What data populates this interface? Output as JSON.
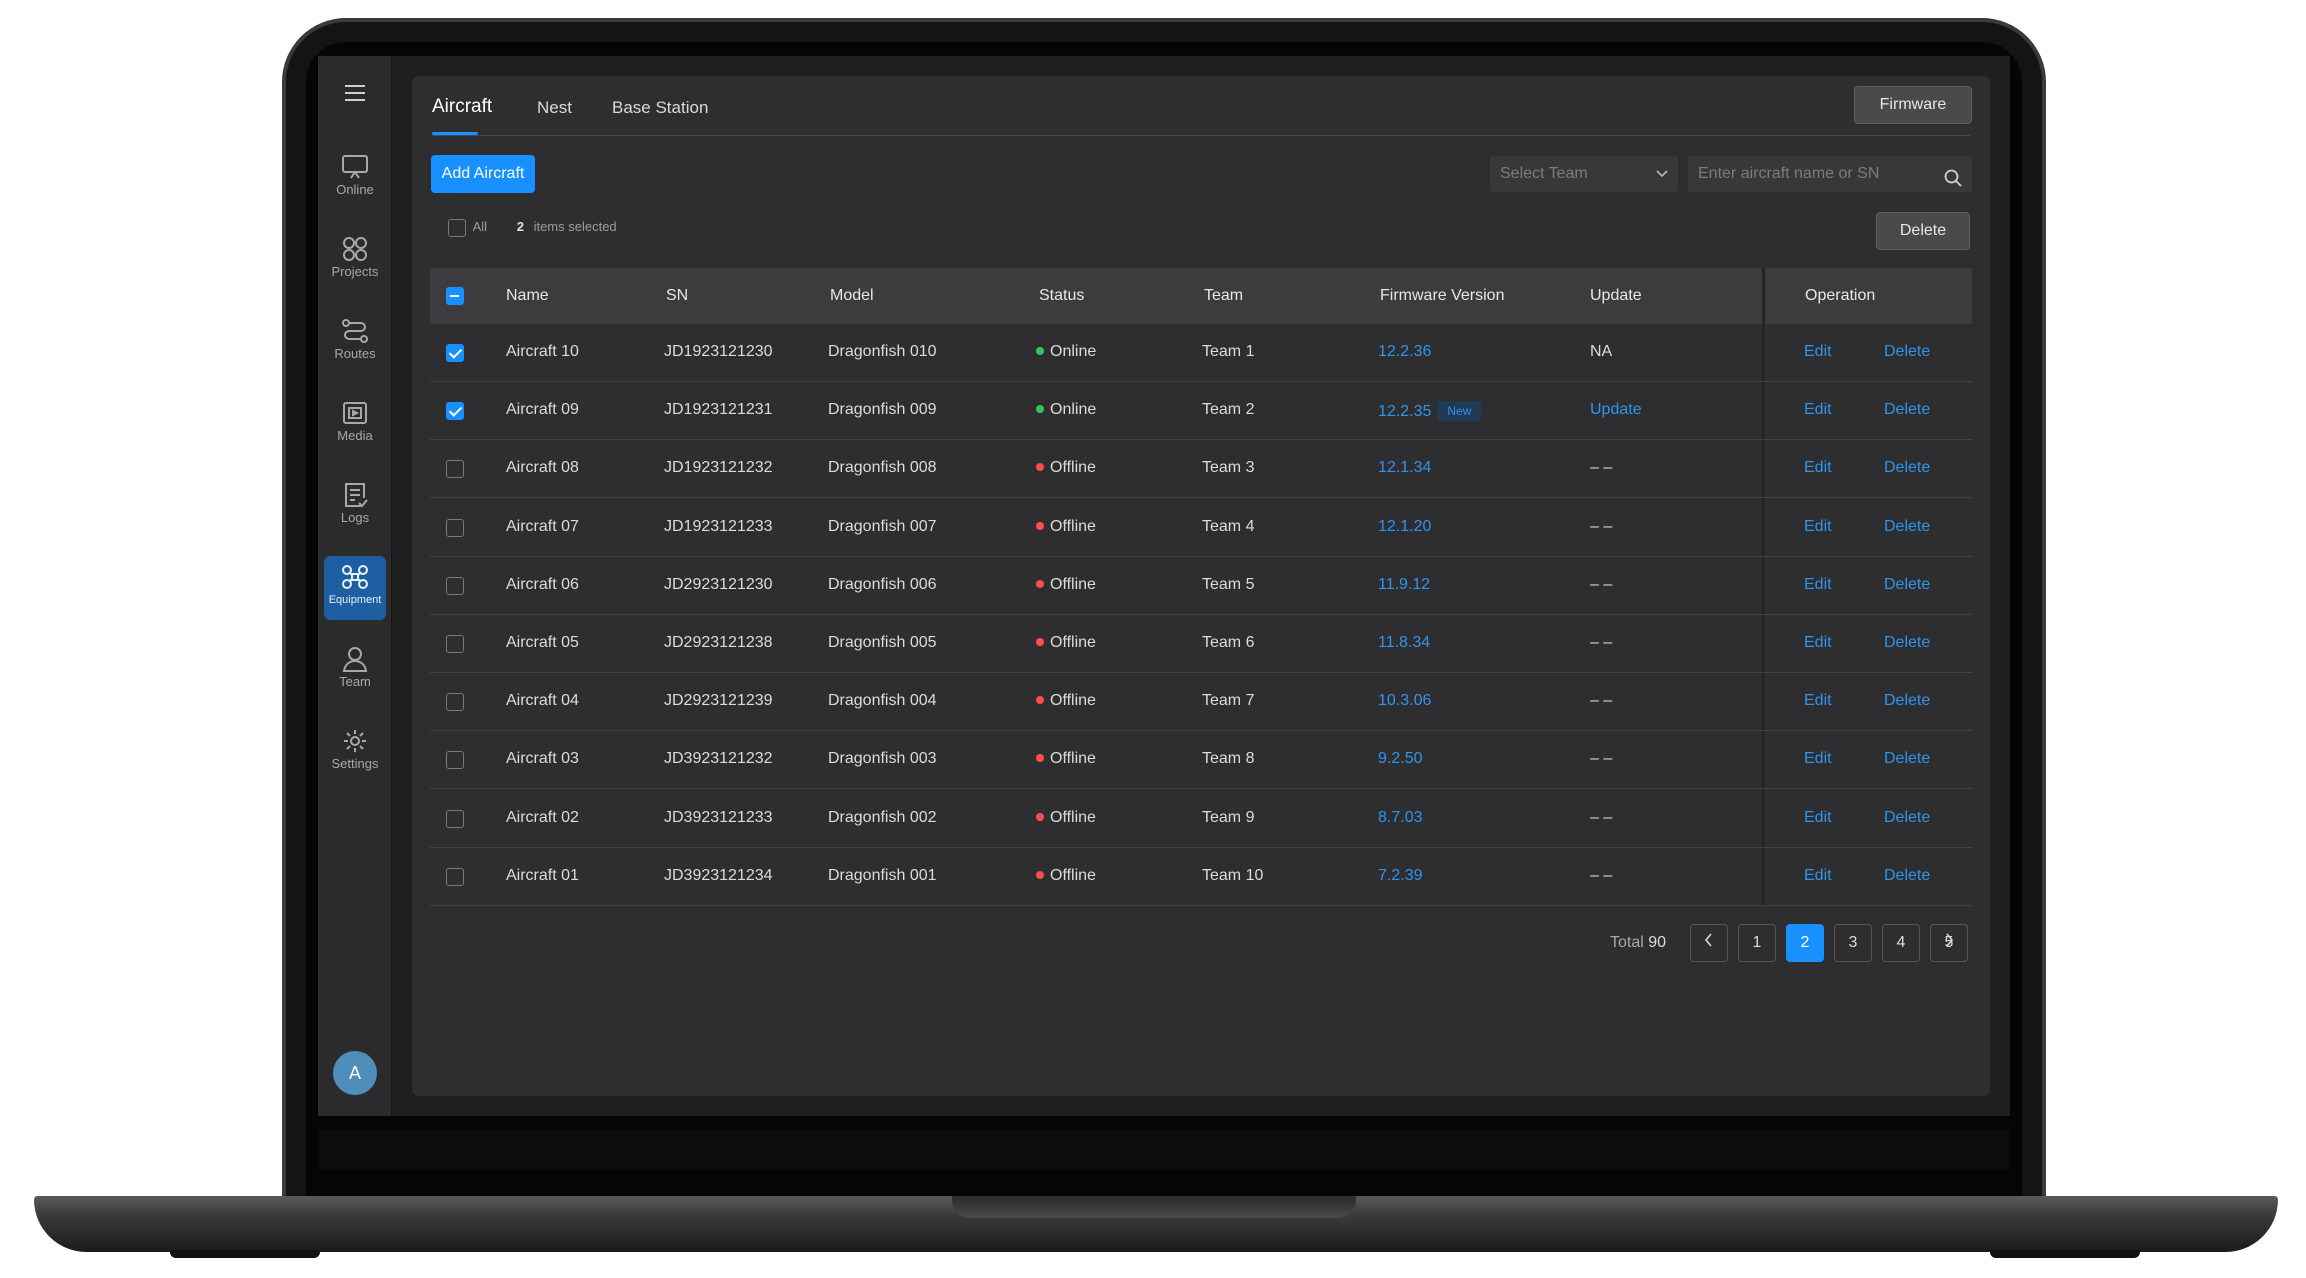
{
  "sidebar": {
    "menu_icon": "hamburger-icon",
    "items": [
      {
        "label": "Online",
        "icon": "monitor-icon"
      },
      {
        "label": "Projects",
        "icon": "grid-circles-icon"
      },
      {
        "label": "Routes",
        "icon": "route-icon"
      },
      {
        "label": "Media",
        "icon": "media-icon"
      },
      {
        "label": "Logs",
        "icon": "log-icon"
      },
      {
        "label": "Equipment",
        "icon": "drone-icon",
        "active": true
      },
      {
        "label": "Team",
        "icon": "person-icon"
      },
      {
        "label": "Settings",
        "icon": "gear-icon"
      }
    ],
    "avatar_initial": "A"
  },
  "tabs": [
    {
      "label": "Aircraft",
      "active": true
    },
    {
      "label": "Nest"
    },
    {
      "label": "Base Station"
    }
  ],
  "toolbar": {
    "firmware_label": "Firmware",
    "add_label": "Add Aircraft",
    "team_placeholder": "Select Team",
    "search_placeholder": "Enter aircraft name or SN",
    "delete_label": "Delete"
  },
  "selection": {
    "all_label": "All",
    "count": "2",
    "suffix": "items selected"
  },
  "table": {
    "columns": [
      "Name",
      "SN",
      "Model",
      "Status",
      "Team",
      "Firmware Version",
      "Update",
      "Operation"
    ],
    "rows": [
      {
        "checked": true,
        "name": "Aircraft 10",
        "sn": "JD1923121230",
        "model": "Dragonfish 010",
        "status": "Online",
        "team": "Team 1",
        "firmware": "12.2.36",
        "badge": "",
        "update": "NA",
        "update_link": false
      },
      {
        "checked": true,
        "name": "Aircraft 09",
        "sn": "JD1923121231",
        "model": "Dragonfish 009",
        "status": "Online",
        "team": "Team 2",
        "firmware": "12.2.35",
        "badge": "New",
        "update": "Update",
        "update_link": true
      },
      {
        "checked": false,
        "name": "Aircraft 08",
        "sn": "JD1923121232",
        "model": "Dragonfish 008",
        "status": "Offline",
        "team": "Team 3",
        "firmware": "12.1.34",
        "badge": "",
        "update": "– –",
        "update_link": false
      },
      {
        "checked": false,
        "name": "Aircraft 07",
        "sn": "JD1923121233",
        "model": "Dragonfish 007",
        "status": "Offline",
        "team": "Team 4",
        "firmware": "12.1.20",
        "badge": "",
        "update": "– –",
        "update_link": false
      },
      {
        "checked": false,
        "name": "Aircraft 06",
        "sn": "JD2923121230",
        "model": "Dragonfish 006",
        "status": "Offline",
        "team": "Team 5",
        "firmware": "11.9.12",
        "badge": "",
        "update": "– –",
        "update_link": false
      },
      {
        "checked": false,
        "name": "Aircraft 05",
        "sn": "JD2923121238",
        "model": "Dragonfish 005",
        "status": "Offline",
        "team": "Team 6",
        "firmware": "11.8.34",
        "badge": "",
        "update": "– –",
        "update_link": false
      },
      {
        "checked": false,
        "name": "Aircraft 04",
        "sn": "JD2923121239",
        "model": "Dragonfish 004",
        "status": "Offline",
        "team": "Team 7",
        "firmware": "10.3.06",
        "badge": "",
        "update": "– –",
        "update_link": false
      },
      {
        "checked": false,
        "name": "Aircraft 03",
        "sn": "JD3923121232",
        "model": "Dragonfish 003",
        "status": "Offline",
        "team": "Team 8",
        "firmware": "9.2.50",
        "badge": "",
        "update": "– –",
        "update_link": false
      },
      {
        "checked": false,
        "name": "Aircraft 02",
        "sn": "JD3923121233",
        "model": "Dragonfish 002",
        "status": "Offline",
        "team": "Team 9",
        "firmware": "8.7.03",
        "badge": "",
        "update": "– –",
        "update_link": false
      },
      {
        "checked": false,
        "name": "Aircraft 01",
        "sn": "JD3923121234",
        "model": "Dragonfish 001",
        "status": "Offline",
        "team": "Team 10",
        "firmware": "7.2.39",
        "badge": "",
        "update": "– –",
        "update_link": false
      }
    ],
    "edit_label": "Edit",
    "delete_label": "Delete"
  },
  "pagination": {
    "total_label": "Total",
    "total": "90",
    "pages": [
      "1",
      "2",
      "3",
      "4",
      "5"
    ],
    "current": "2",
    "prev_icon": "chevron-left-icon",
    "next_icon": "chevron-right-icon"
  },
  "colors": {
    "accent": "#1890ff",
    "online": "#3cc15a",
    "offline": "#ff4d4f",
    "link": "#2f95ee"
  }
}
